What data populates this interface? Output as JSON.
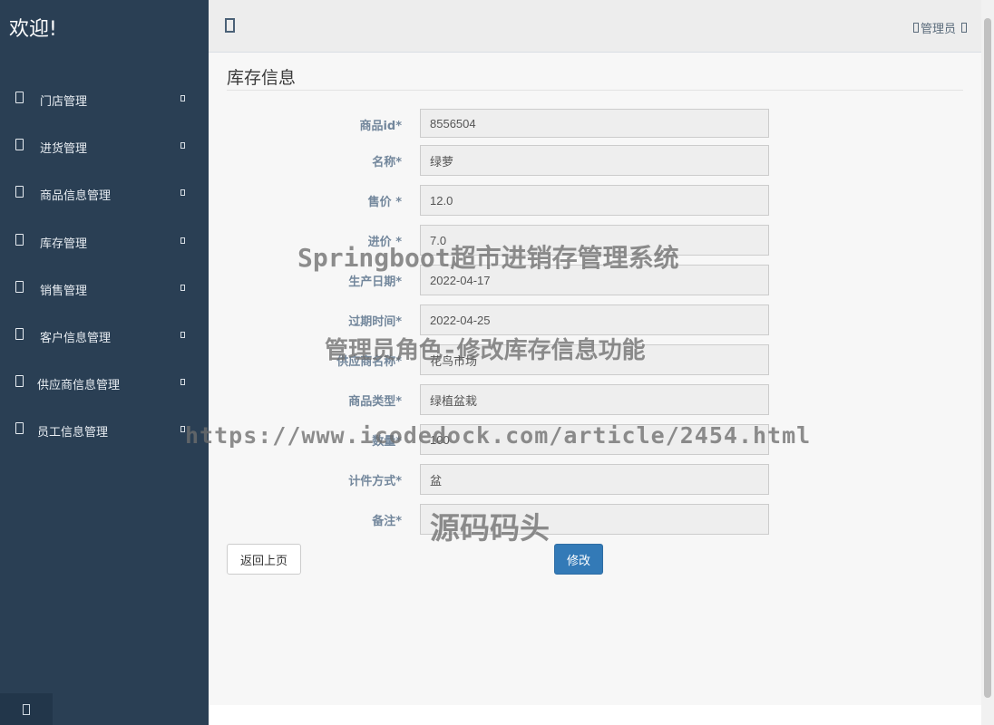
{
  "sidebar": {
    "welcome": "欢迎!",
    "items": [
      {
        "label": "门店管理"
      },
      {
        "label": "进货管理"
      },
      {
        "label": "商品信息管理"
      },
      {
        "label": "库存管理"
      },
      {
        "label": "销售管理"
      },
      {
        "label": "客户信息管理"
      },
      {
        "label": "供应商信息管理"
      },
      {
        "label": "员工信息管理"
      }
    ]
  },
  "topbar": {
    "user_label": "管理员"
  },
  "main": {
    "title": "库存信息",
    "fields": [
      {
        "label": "商品id*",
        "value": "8556504"
      },
      {
        "label": "名称*",
        "value": "绿萝"
      },
      {
        "label": "售价 *",
        "value": "12.0"
      },
      {
        "label": "进价 *",
        "value": "7.0"
      },
      {
        "label": "生产日期*",
        "value": "2022-04-17"
      },
      {
        "label": "过期时间*",
        "value": "2022-04-25"
      },
      {
        "label": "供应商名称*",
        "value": "花鸟市场"
      },
      {
        "label": "商品类型*",
        "value": "绿植盆栽"
      },
      {
        "label": "数量*",
        "value": "100"
      },
      {
        "label": "计件方式*",
        "value": "盆"
      },
      {
        "label": "备注*",
        "value": ""
      }
    ],
    "back_button": "返回上页",
    "submit_button": "修改"
  },
  "watermarks": {
    "line1": "Springboot超市进销存管理系统",
    "line2": "管理员角色-修改库存信息功能",
    "line3": "https://www.icodedock.com/article/2454.html",
    "line4": "源码码头"
  },
  "icons": {
    "nav": "menu-item-icon",
    "chevron": "chevron-icon",
    "toggle": "menu-toggle-icon",
    "footer": "logout-icon"
  },
  "colors": {
    "sidebar": "#2a3f54",
    "primary_button": "#337ab7",
    "label": "#73879c"
  }
}
